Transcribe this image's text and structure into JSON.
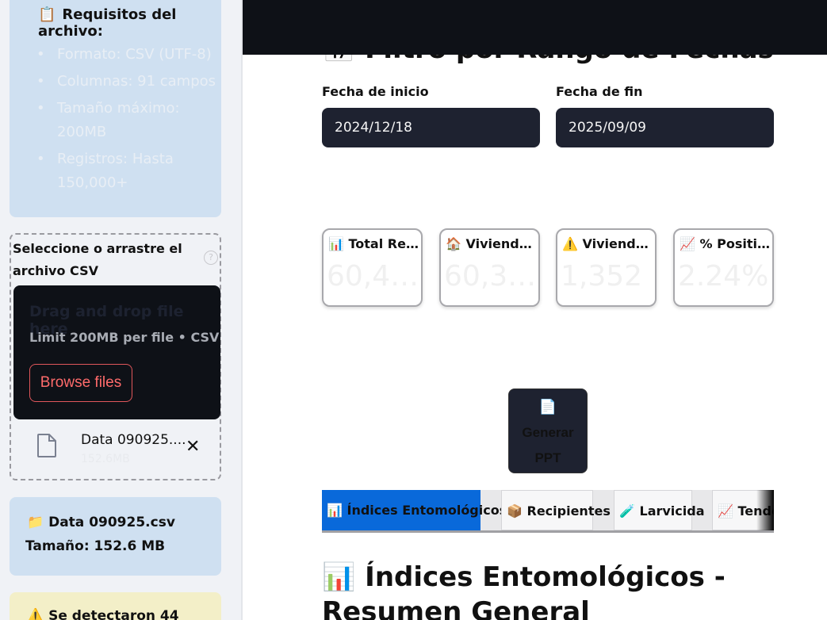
{
  "sidebar": {
    "requirements": {
      "icon": "clipboard-icon",
      "title": "Requisitos del archivo:",
      "items": [
        "Formato: CSV (UTF-8)",
        "Columnas: 91 campos",
        "Tamaño máximo: 200MB",
        "Registros: Hasta 150,000+"
      ]
    },
    "uploader": {
      "label": "Seleccione o arrastre el archivo CSV",
      "help_icon": "question-icon",
      "drop_title": "Drag and drop file here",
      "drop_subtitle": "Limit 200MB per file • CSV",
      "browse_label": "Browse files",
      "file": {
        "name": "Data 090925....",
        "size": "152.6MB"
      }
    },
    "file_info": {
      "icon": "folder-icon",
      "name": "Data 090925.csv",
      "size": "Tamaño: 152.6 MB"
    },
    "warning": {
      "icon": "warning-icon",
      "text": "Se detectaron 44"
    }
  },
  "main": {
    "section_title": "📅 Filtro por Rango de Fechas",
    "start_date": {
      "label": "Fecha de inicio",
      "value": "2024/12/18"
    },
    "end_date": {
      "label": "Fecha de fin",
      "value": "2025/09/09"
    },
    "metrics": [
      {
        "icon": "📊",
        "label": "📊 Total Registros",
        "value": "60,4…"
      },
      {
        "icon": "🏠",
        "label": "🏠 Viviendas Inspeccionadas",
        "value": "60,3…"
      },
      {
        "icon": "⚠️",
        "label": "⚠️ Viviendas Positivas",
        "value": "1,352"
      },
      {
        "icon": "📈",
        "label": "📈 % Positividad",
        "value": "2.24%"
      }
    ],
    "ppt_button": {
      "icon": "📄",
      "label": "Generar PPT"
    },
    "tabs": [
      "📊 Índices Entomológicos",
      "📦 Recipientes",
      "🧪 Larvicida",
      "📈 Tendencias"
    ],
    "heading": "📊 Índices Entomológicos - Resumen General"
  },
  "colors": {
    "topbar": "#0e1117",
    "info_box": "#cfe0f1",
    "warning_box": "#f3efc8",
    "active_tab": "#0969da",
    "browse_button": "#ff6b6b",
    "input_bg": "#1e2230"
  }
}
